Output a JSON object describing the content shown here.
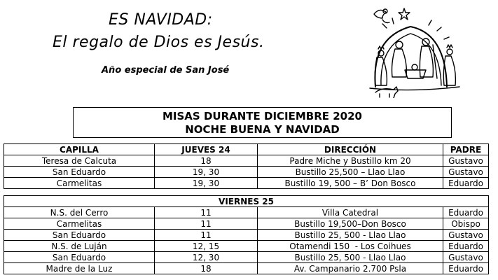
{
  "header": {
    "line1": "ES NAVIDAD:",
    "line2": "El regalo de Dios es Jesús.",
    "subtitle": "Año especial de San José"
  },
  "box": {
    "line1": "MISAS DURANTE DICIEMBRE 2020",
    "line2": "NOCHE BUENA Y NAVIDAD"
  },
  "table1": {
    "headers": [
      "CAPILLA",
      "JUEVES 24",
      "DIRECCIÓN",
      "PADRE"
    ],
    "rows": [
      [
        "Teresa de Calcuta",
        "18",
        "Padre Miche y Bustillo km 20",
        "Gustavo"
      ],
      [
        "San Eduardo",
        "19, 30",
        "Bustillo 25,500 – Llao Llao",
        "Gustavo"
      ],
      [
        "Carmelitas",
        "19, 30",
        "Bustillo 19, 500 – B’ Don Bosco",
        "Eduardo"
      ]
    ]
  },
  "table2": {
    "day": "VIERNES 25",
    "rows": [
      [
        "N.S. del Cerro",
        "11",
        "Villa Catedral",
        "Eduardo"
      ],
      [
        "Carmelitas",
        "11",
        "Bustillo 19,500–Don Bosco",
        "Obispo"
      ],
      [
        "San Eduardo",
        "11",
        "Bustillo 25, 500 - Llao Llao",
        "Gustavo"
      ],
      [
        "N.S. de Luján",
        "12, 15",
        "Otamendi 150  - Los Coihues",
        "Eduardo"
      ],
      [
        "San Eduardo",
        "12, 30",
        "Bustillo 25, 500 - Llao Llao",
        "Gustavo"
      ],
      [
        "Madre de la Luz",
        "18",
        "Av. Campanario 2.700 Psla",
        "Eduardo"
      ]
    ]
  },
  "illustration": {
    "icon": "nativity-scene-icon"
  }
}
